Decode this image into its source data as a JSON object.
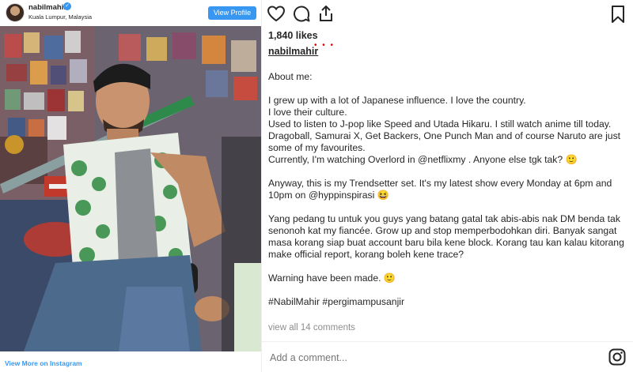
{
  "post_header": {
    "username": "nabilmahir",
    "location": "Kuala Lumpur, Malaysia",
    "view_profile_label": "View Profile",
    "verified_glyph": "✓"
  },
  "footer_left": {
    "view_more_label": "View More on Instagram"
  },
  "actions": {
    "icons": [
      "heart-icon",
      "comment-icon",
      "share-icon",
      "bookmark-icon"
    ]
  },
  "likes": "1,840 likes",
  "caption": {
    "author": "nabilmahir",
    "paragraphs": [
      "About me:",
      "",
      "I grew up with a lot of Japanese influence. I love the country.",
      "I love their culture.",
      "Used to listen to J-pop like Speed and Utada Hikaru. I still watch anime till today. Dragoball, Samurai X, Get Backers, One Punch Man and of course Naruto are just some of my favourites.",
      "Currently, I'm watching Overlord in @netflixmy . Anyone else tgk tak? 🙂",
      "",
      "Anyway, this is my Trendsetter set. It's my latest show every Monday at 6pm and 10pm on @hyppinspirasi 😆",
      "",
      "Yang pedang tu untuk you guys yang batang gatal tak abis-abis nak DM benda tak senonoh kat my fiancée. Grow up and stop memperbodohkan diri. Banyak sangat masa korang siap buat account baru bila kene block. Korang tau kan kalau kitorang make official report, korang boleh kene trace?",
      "",
      "Warning have been made. 🙂",
      "",
      "#NabilMahir #pergimampusanjir"
    ]
  },
  "view_all_comments": "view all 14 comments",
  "comment_input": {
    "placeholder": "Add a comment..."
  },
  "colors": {
    "link_blue": "#3897f0",
    "text": "#262626",
    "muted": "#8e8e8e"
  }
}
